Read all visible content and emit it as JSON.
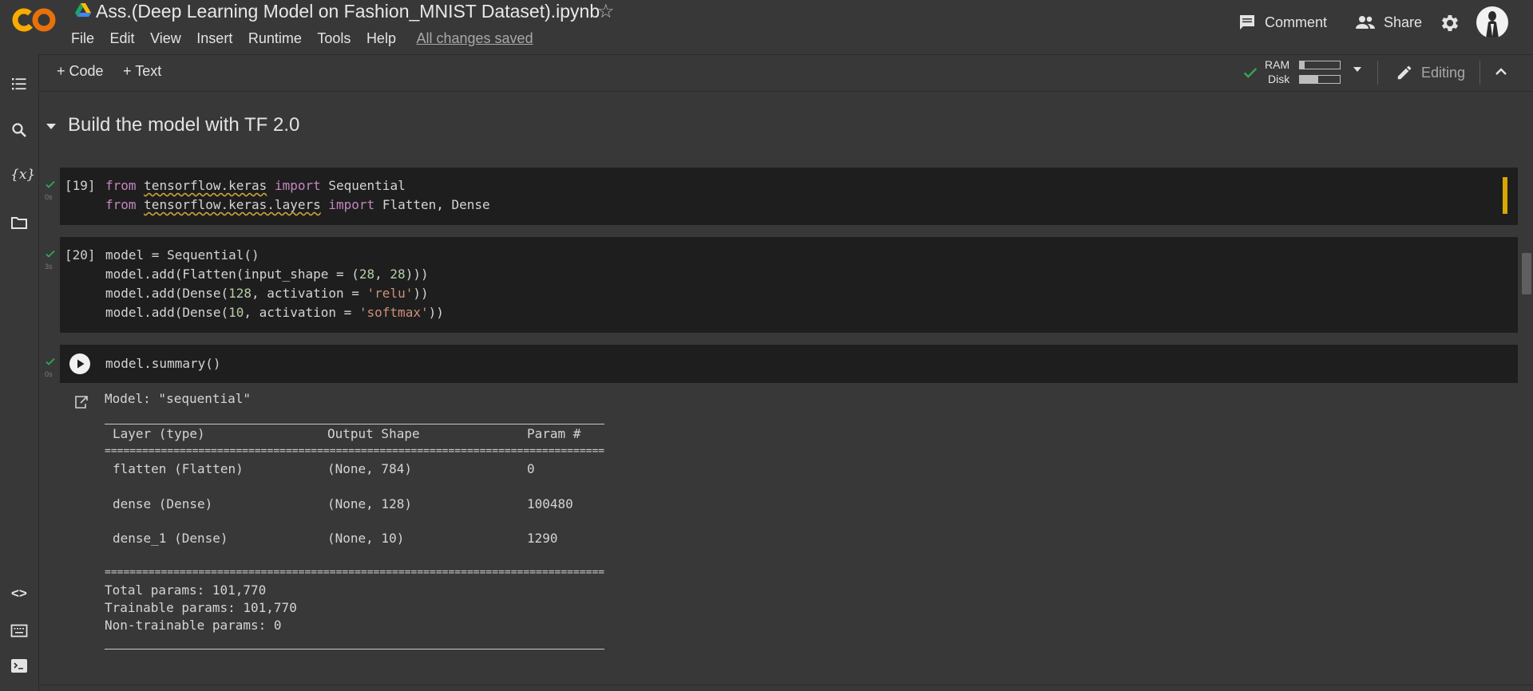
{
  "header": {
    "title": "Ass.(Deep Learning Model on Fashion_MNIST Dataset).ipynb",
    "menu": [
      "File",
      "Edit",
      "View",
      "Insert",
      "Runtime",
      "Tools",
      "Help"
    ],
    "save_status": "All changes saved",
    "comment_label": "Comment",
    "share_label": "Share"
  },
  "toolbar": {
    "add_code_label": "+ Code",
    "add_text_label": "+ Text",
    "ram_label": "RAM",
    "disk_label": "Disk",
    "ram_usage_fraction": 0.12,
    "disk_usage_fraction": 0.45,
    "editing_label": "Editing"
  },
  "section": {
    "title": "Build the model with TF 2.0"
  },
  "cells": [
    {
      "exec_count": "[19]",
      "duration": "0s",
      "lines": [
        [
          "from",
          "tensorflow.keras",
          "import",
          "Sequential"
        ],
        [
          "from",
          "tensorflow.keras.layers",
          "import",
          "Flatten, Dense"
        ]
      ]
    },
    {
      "exec_count": "[20]",
      "duration": "3s",
      "lines": [
        "model = Sequential()",
        "model.add(Flatten(input_shape = (28, 28)))",
        "model.add(Dense(128, activation = 'relu'))",
        "model.add(Dense(10, activation = 'softmax'))"
      ]
    },
    {
      "exec_count": "",
      "duration": "0s",
      "lines": [
        "model.summary()"
      ]
    }
  ],
  "output": {
    "model_line": "Model: \"sequential\"",
    "headers": [
      "Layer (type)",
      "Output Shape",
      "Param #"
    ],
    "rows": [
      [
        "flatten (Flatten)",
        "(None, 784)",
        "0"
      ],
      [
        "dense (Dense)",
        "(None, 128)",
        "100480"
      ],
      [
        "dense_1 (Dense)",
        "(None, 10)",
        "1290"
      ]
    ],
    "total_params": "Total params: 101,770",
    "trainable_params": "Trainable params: 101,770",
    "non_trainable_params": "Non-trainable params: 0"
  },
  "colors": {
    "background": "#383838",
    "cell_background": "#1e1e1e",
    "keyword": "#c586c0",
    "number": "#b5cea8",
    "string": "#ce9178",
    "success_check": "#34a853",
    "logo_orange": "#f9ab00",
    "focus_bar": "#d8a800"
  },
  "icons": {
    "sidebar": [
      "table-of-contents-icon",
      "search-icon",
      "variables-icon",
      "files-icon",
      "code-snippets-icon",
      "command-palette-icon",
      "terminal-icon"
    ]
  }
}
